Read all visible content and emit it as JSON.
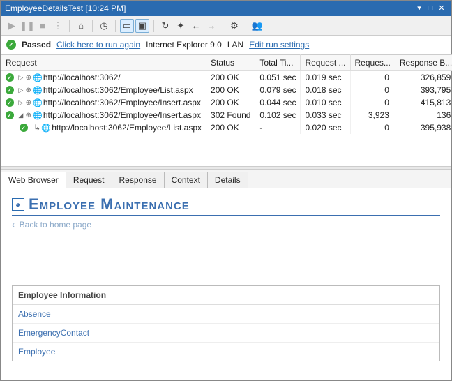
{
  "window": {
    "title": "EmployeeDetailsTest [10:24 PM]"
  },
  "toolbar": {
    "icons": [
      "play",
      "pause",
      "stop",
      "dots",
      "home",
      "clock",
      "window",
      "folder",
      "refresh",
      "bolt",
      "back",
      "fwd",
      "config",
      "people"
    ]
  },
  "status": {
    "passed": "Passed",
    "run_again": "Click here to run again",
    "browser": "Internet Explorer 9.0",
    "network": "LAN",
    "edit_settings": "Edit run settings"
  },
  "grid": {
    "headers": {
      "request": "Request",
      "status": "Status",
      "total_time": "Total Ti...",
      "request_time": "Request ...",
      "request_bytes": "Reques...",
      "response_bytes": "Response B..."
    },
    "rows": [
      {
        "url": "http://localhost:3062/",
        "status": "200 OK",
        "total": "0.051 sec",
        "req": "0.019 sec",
        "reqb": "0",
        "resb": "326,859",
        "child": false
      },
      {
        "url": "http://localhost:3062/Employee/List.aspx",
        "status": "200 OK",
        "total": "0.079 sec",
        "req": "0.018 sec",
        "reqb": "0",
        "resb": "393,795",
        "child": false
      },
      {
        "url": "http://localhost:3062/Employee/Insert.aspx",
        "status": "200 OK",
        "total": "0.044 sec",
        "req": "0.010 sec",
        "reqb": "0",
        "resb": "415,813",
        "child": false
      },
      {
        "url": "http://localhost:3062/Employee/Insert.aspx",
        "status": "302 Found",
        "total": "0.102 sec",
        "req": "0.033 sec",
        "reqb": "3,923",
        "resb": "136",
        "child": false,
        "expanded": true
      },
      {
        "url": "http://localhost:3062/Employee/List.aspx",
        "status": "200 OK",
        "total": "-",
        "req": "0.020 sec",
        "reqb": "0",
        "resb": "395,938",
        "child": true
      }
    ]
  },
  "tabs": {
    "items": [
      "Web Browser",
      "Request",
      "Response",
      "Context",
      "Details"
    ],
    "active": 0
  },
  "page": {
    "title": "Employee Maintenance",
    "back": "Back to home page",
    "back_arrow": "‹",
    "section_header": "Employee Information",
    "items": [
      "Absence",
      "EmergencyContact",
      "Employee"
    ]
  }
}
